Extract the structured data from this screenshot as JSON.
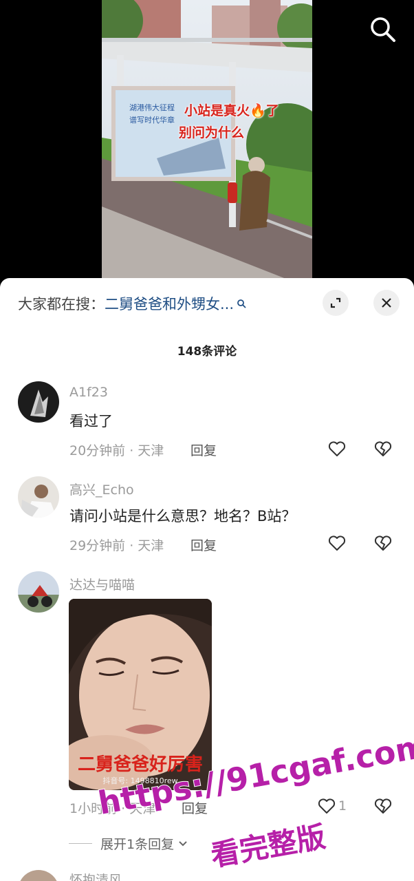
{
  "video": {
    "overlay_line1": "小站是真火🔥了",
    "overlay_line2": "别问为什么",
    "billboard_line1": "湖港伟大征程",
    "billboard_line2": "谱写时代华章",
    "search_icon": "search-icon"
  },
  "sheet": {
    "search_prefix": "大家都在搜：",
    "search_query": "二舅爸爸和外甥女...",
    "count_title": "148条评论",
    "expand_icon": "expand-icon",
    "close_icon": "close-icon"
  },
  "comments": [
    {
      "user": "A1f23",
      "text": "看过了",
      "time_location": "20分钟前 · 天津",
      "reply_label": "回复",
      "like_count": ""
    },
    {
      "user": "高兴_Echo",
      "text": "请问小站是什么意思？地名？B站？",
      "time_location": "29分钟前 · 天津",
      "reply_label": "回复",
      "like_count": ""
    },
    {
      "user": "达达与喵喵",
      "image_caption": "二舅爸爸好厉害",
      "image_watermark": "抖音号: 1498810rew",
      "time_location": "1小时前 · 天津",
      "reply_label": "回复",
      "like_count": "1",
      "expand_label": "展开1条回复"
    },
    {
      "user": "怀抱清风"
    }
  ],
  "watermark": {
    "url": "https://91cgaf.com",
    "tagline": "看完整版"
  },
  "colors": {
    "accent_link": "#1f4e84",
    "muted_text": "#9a9a9a",
    "watermark": "#b620a8",
    "overlay_red": "#d8231c"
  }
}
